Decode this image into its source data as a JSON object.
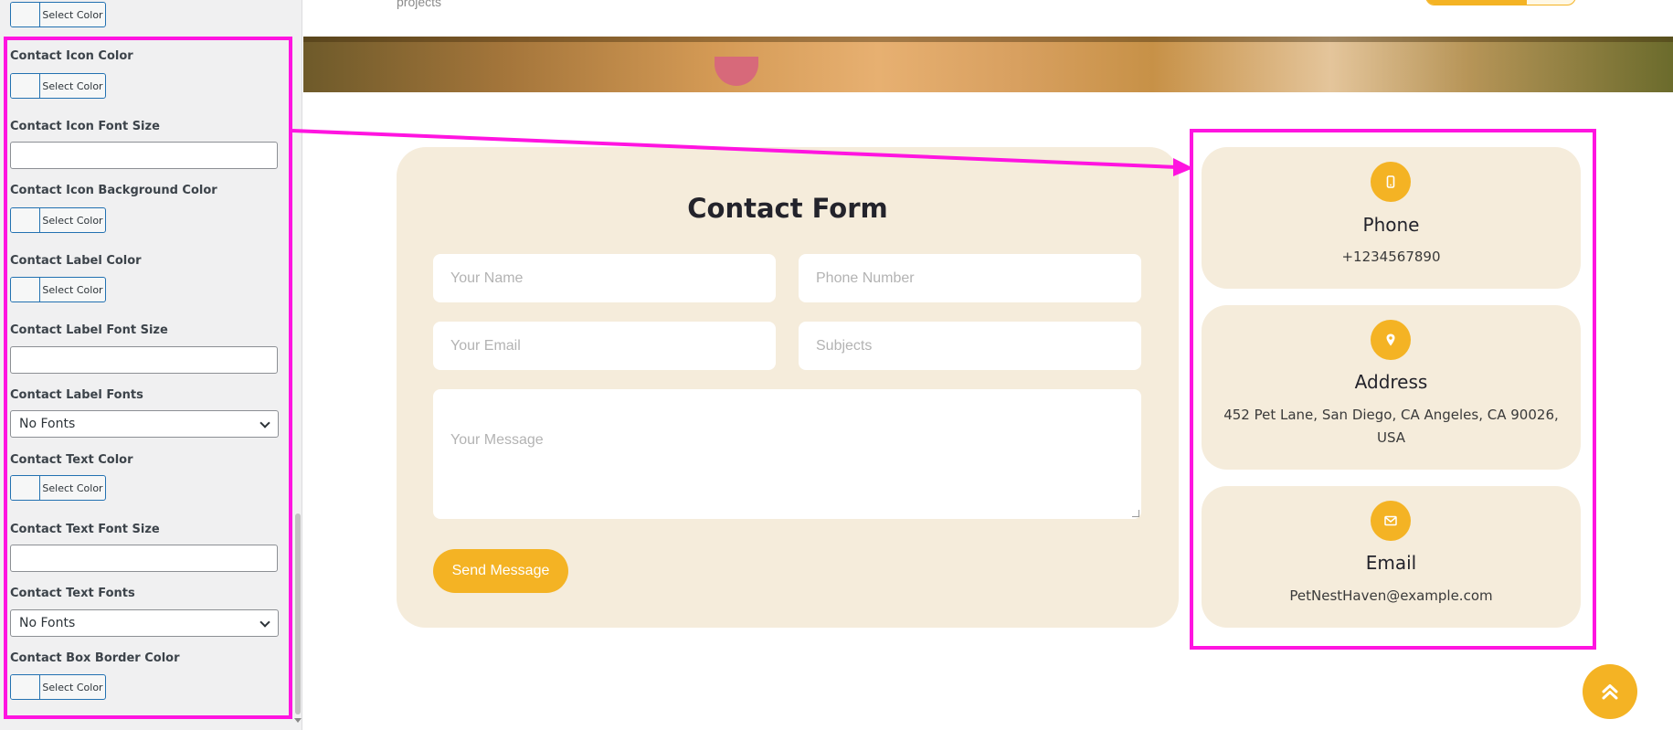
{
  "customizer": {
    "top_partial_button": "Select Color",
    "controls": {
      "icon_color": {
        "label": "Contact Icon Color",
        "button": "Select Color"
      },
      "icon_font_size": {
        "label": "Contact Icon Font Size",
        "value": ""
      },
      "icon_bg_color": {
        "label": "Contact Icon Background Color",
        "button": "Select Color"
      },
      "label_color": {
        "label": "Contact Label Color",
        "button": "Select Color"
      },
      "label_font_size": {
        "label": "Contact Label Font Size",
        "value": ""
      },
      "label_fonts": {
        "label": "Contact Label Fonts",
        "selected": "No Fonts"
      },
      "text_color": {
        "label": "Contact Text Color",
        "button": "Select Color"
      },
      "text_font_size": {
        "label": "Contact Text Font Size",
        "value": ""
      },
      "text_fonts": {
        "label": "Contact Text Fonts",
        "selected": "No Fonts"
      },
      "box_border_color": {
        "label": "Contact Box Border Color",
        "button": "Select Color"
      }
    }
  },
  "preview": {
    "top_subtext": "projects",
    "contact_form": {
      "title": "Contact Form",
      "name_placeholder": "Your Name",
      "phone_placeholder": "Phone Number",
      "email_placeholder": "Your Email",
      "subject_placeholder": "Subjects",
      "message_placeholder": "Your Message",
      "submit_label": "Send Message"
    },
    "contact_cards": {
      "phone": {
        "icon": "phone-icon",
        "title": "Phone",
        "text": "+1234567890"
      },
      "address": {
        "icon": "map-pin-icon",
        "title": "Address",
        "text": "452 Pet Lane, San Diego, CA Angeles, CA 90026, USA"
      },
      "email": {
        "icon": "envelope-icon",
        "title": "Email",
        "text": "PetNestHaven@example.com"
      }
    },
    "scroll_top_icon": "double-chevron-up-icon"
  },
  "colors": {
    "accent": "#f4b324",
    "card_background": "#f5ecdb",
    "annotation": "#ff14e0",
    "panel_background": "#f0f0f1",
    "wp_blue": "#2271b1"
  }
}
